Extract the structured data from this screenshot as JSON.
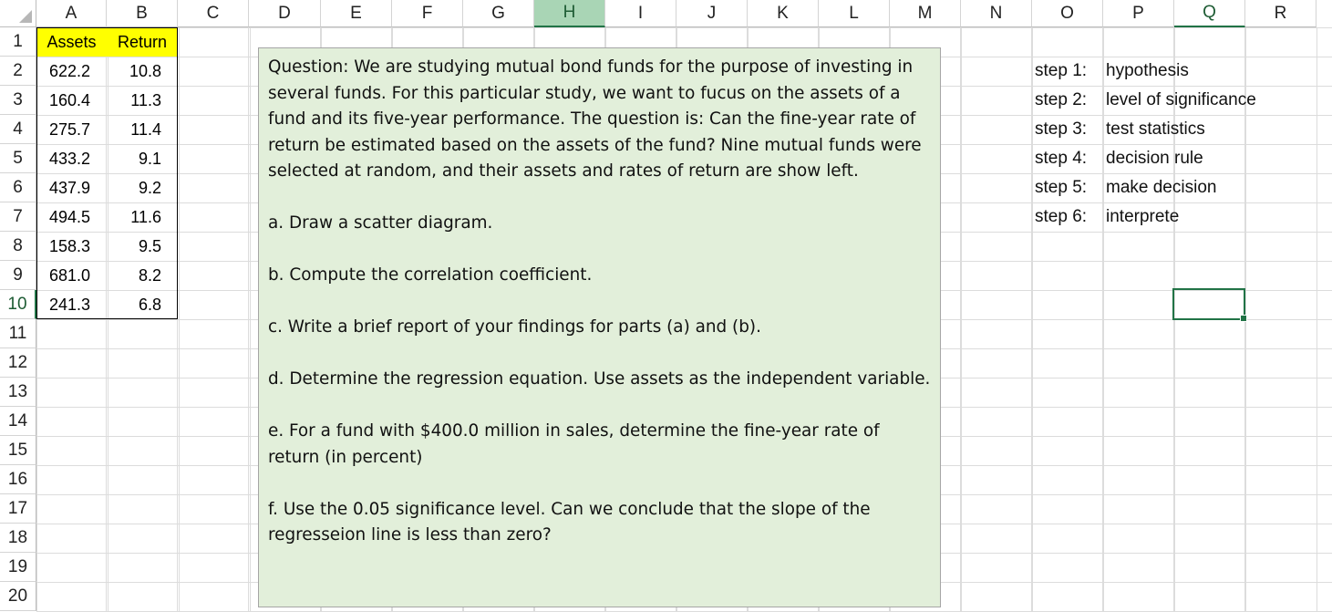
{
  "columns": [
    "A",
    "B",
    "C",
    "D",
    "E",
    "F",
    "G",
    "H",
    "I",
    "J",
    "K",
    "L",
    "M",
    "N",
    "O",
    "P",
    "Q",
    "R"
  ],
  "rows": [
    "1",
    "2",
    "3",
    "4",
    "5",
    "6",
    "7",
    "8",
    "9",
    "10",
    "11",
    "12",
    "13",
    "14",
    "15",
    "16",
    "17",
    "18",
    "19",
    "20"
  ],
  "table": {
    "headers": [
      "Assets",
      "Return"
    ],
    "rows": [
      [
        "622.2",
        "10.8"
      ],
      [
        "160.4",
        "11.3"
      ],
      [
        "275.7",
        "11.4"
      ],
      [
        "433.2",
        "9.1"
      ],
      [
        "437.9",
        "9.2"
      ],
      [
        "494.5",
        "11.6"
      ],
      [
        "158.3",
        "9.5"
      ],
      [
        "681.0",
        "8.2"
      ],
      [
        "241.3",
        "6.8"
      ]
    ]
  },
  "question": {
    "intro": "Question: We are studying mutual bond funds for the purpose of investing in several  funds. For this particular study, we want to fucus on the assets of a fund and its five-year performance. The question is: Can the fine-year rate of return be estimated based on the assets of the fund? Nine mutual funds were selected at random, and their assets and rates of return are show left.",
    "parts": [
      "a. Draw a scatter diagram.",
      "b. Compute the correlation coefficient.",
      "c. Write a brief report of your findings for parts (a) and (b).",
      "d. Determine the regression equation. Use assets as the independent variable.",
      "e. For a fund with $400.0 million in sales, determine the fine-year rate of return (in percent)",
      "f. Use the 0.05 significance level. Can we conclude that the slope of the regresseion line is less than zero?"
    ]
  },
  "steps": [
    {
      "label": "step 1:",
      "text": "hypothesis"
    },
    {
      "label": "step 2:",
      "text": "level of significance"
    },
    {
      "label": "step 3:",
      "text": "test statistics"
    },
    {
      "label": "step 4:",
      "text": "decision rule"
    },
    {
      "label": "step 5:",
      "text": "make decision"
    },
    {
      "label": "step 6:",
      "text": "interprete"
    }
  ],
  "colors": {
    "header_fill": "#ffff00",
    "textbox_fill": "#e2efda",
    "selection": "#217346"
  }
}
